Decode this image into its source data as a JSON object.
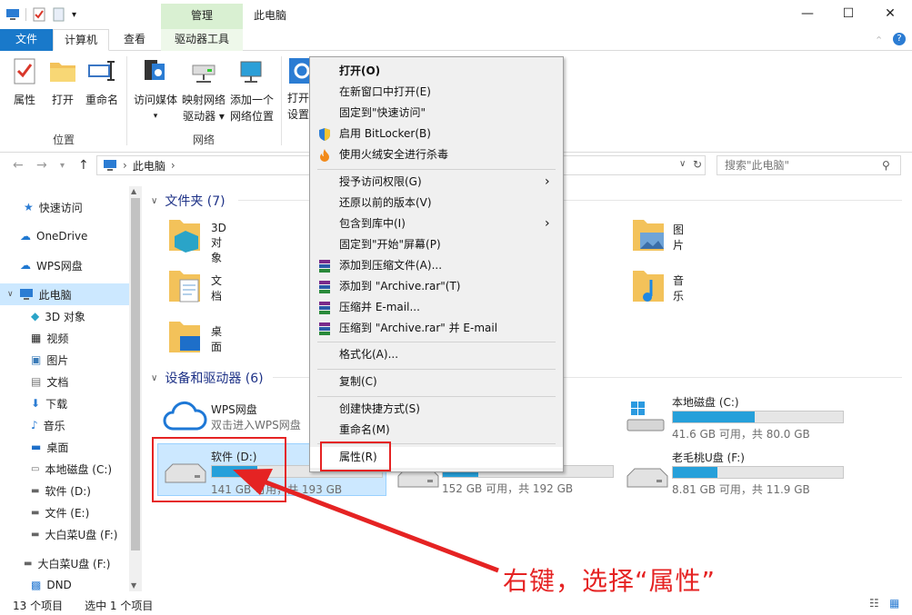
{
  "titlebar": {
    "context_group": "管理",
    "window_title": "此电脑",
    "minimize": "—",
    "maximize": "☐",
    "close": "✕"
  },
  "tabs": {
    "file": "文件",
    "computer": "计算机",
    "view": "查看",
    "drive_tools": "驱动器工具"
  },
  "ribbon": {
    "properties": "属性",
    "open": "打开",
    "rename": "重命名",
    "access_media": "访问媒体",
    "map_drive_1": "映射网络",
    "map_drive_2": "驱动器",
    "add_location_1": "添加一个",
    "add_location_2": "网络位置",
    "open_settings_1": "打开",
    "open_settings_2": "设置",
    "group_location": "位置",
    "group_network": "网络"
  },
  "address": {
    "path": "此电脑",
    "search_placeholder": "搜索\"此电脑\""
  },
  "nav": {
    "quick_access": "快速访问",
    "onedrive": "OneDrive",
    "wps": "WPS网盘",
    "this_pc": "此电脑",
    "objects3d": "3D 对象",
    "videos": "视频",
    "pictures": "图片",
    "documents": "文档",
    "downloads": "下载",
    "music": "音乐",
    "desktop": "桌面",
    "local_c": "本地磁盘 (C:)",
    "soft_d": "软件 (D:)",
    "file_e": "文件 (E:)",
    "usb_f": "大白菜U盘 (F:)",
    "usb_f2": "大白菜U盘 (F:)",
    "dnd": "DND"
  },
  "folders_section": "文件夹 (7)",
  "folders": {
    "objects3d": "3D 对象",
    "pictures": "图片",
    "documents": "文档",
    "music": "音乐",
    "desktop": "桌面"
  },
  "devices_section": "设备和驱动器 (6)",
  "drives": {
    "wps_name": "WPS网盘",
    "wps_sub": "双击进入WPS网盘",
    "c_name": "本地磁盘 (C:)",
    "c_sub": "41.6 GB 可用，共 80.0 GB",
    "c_used": 0.48,
    "d_name": "软件 (D:)",
    "d_sub": "141 GB 可用，共 193 GB",
    "d_used": 0.27,
    "e_sub": "152 GB 可用，共 192 GB",
    "e_used": 0.21,
    "f_name": "老毛桃U盘 (F:)",
    "f_sub": "8.81 GB 可用，共 11.9 GB",
    "f_used": 0.26
  },
  "status": {
    "count": "13 个项目",
    "selected": "选中 1 个项目"
  },
  "context_menu": {
    "open": "打开(O)",
    "open_new": "在新窗口中打开(E)",
    "pin_quick": "固定到\"快速访问\"",
    "bitlocker": "启用 BitLocker(B)",
    "huorong": "使用火绒安全进行杀毒",
    "grant": "授予访问权限(G)",
    "restore": "还原以前的版本(V)",
    "include": "包含到库中(I)",
    "pin_start": "固定到\"开始\"屏幕(P)",
    "add_archive": "添加到压缩文件(A)...",
    "add_rar": "添加到 \"Archive.rar\"(T)",
    "compress_email": "压缩并 E-mail...",
    "compress_rar_email": "压缩到 \"Archive.rar\" 并 E-mail",
    "format": "格式化(A)...",
    "copy": "复制(C)",
    "shortcut": "创建快捷方式(S)",
    "rename": "重命名(M)",
    "properties": "属性(R)"
  },
  "annotation": "右键，选择“属性”"
}
